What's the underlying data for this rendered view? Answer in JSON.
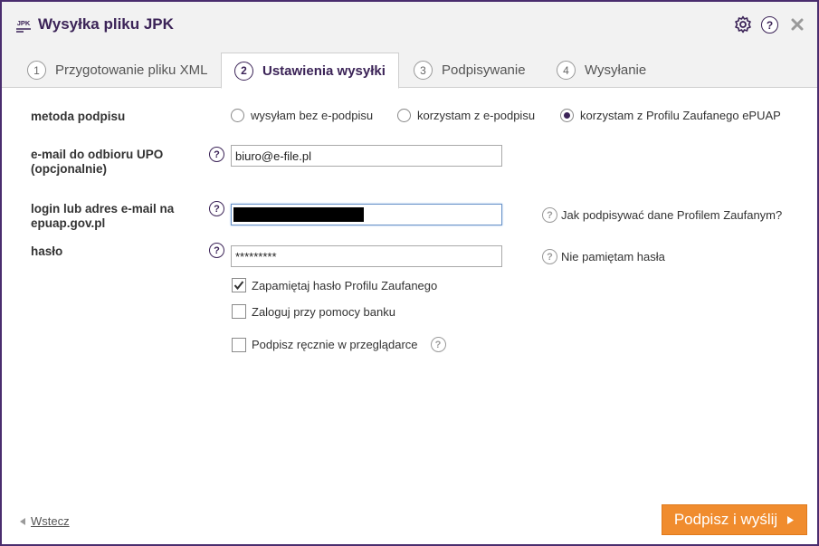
{
  "window": {
    "title": "Wysyłka pliku JPK",
    "logo_text": "JPK"
  },
  "tabs": [
    {
      "num": "1",
      "label": "Przygotowanie pliku XML"
    },
    {
      "num": "2",
      "label": "Ustawienia wysyłki"
    },
    {
      "num": "3",
      "label": "Podpisywanie"
    },
    {
      "num": "4",
      "label": "Wysyłanie"
    }
  ],
  "form": {
    "signature_method": {
      "label": "metoda podpisu",
      "options": [
        "wysyłam bez e-podpisu",
        "korzystam z e-podpisu",
        "korzystam z Profilu Zaufanego ePUAP"
      ],
      "selected": "korzystam z Profilu Zaufanego ePUAP"
    },
    "email_upo": {
      "label_line1": "e-mail do odbioru UPO",
      "label_line2": "(opcjonalnie)",
      "value": "biuro@e-file.pl"
    },
    "login": {
      "label_line1": "login lub adres e-mail na",
      "label_line2": "epuap.gov.pl",
      "help_link": "Jak podpisywać dane Profilem Zaufanym?"
    },
    "password": {
      "label": "hasło",
      "value": "*********",
      "help_link": "Nie pamiętam hasła"
    },
    "checkboxes": [
      {
        "label": "Zapamiętaj hasło Profilu Zaufanego",
        "checked": true
      },
      {
        "label": "Zaloguj przy pomocy banku",
        "checked": false
      },
      {
        "label": "Podpisz ręcznie w przeglądarce",
        "checked": false
      }
    ],
    "help_glyph": "?"
  },
  "footer": {
    "back_label": "Wstecz",
    "submit_label": "Podpisz i wyślij"
  },
  "colors": {
    "accent": "#3b2357",
    "submit": "#f08c2e"
  }
}
